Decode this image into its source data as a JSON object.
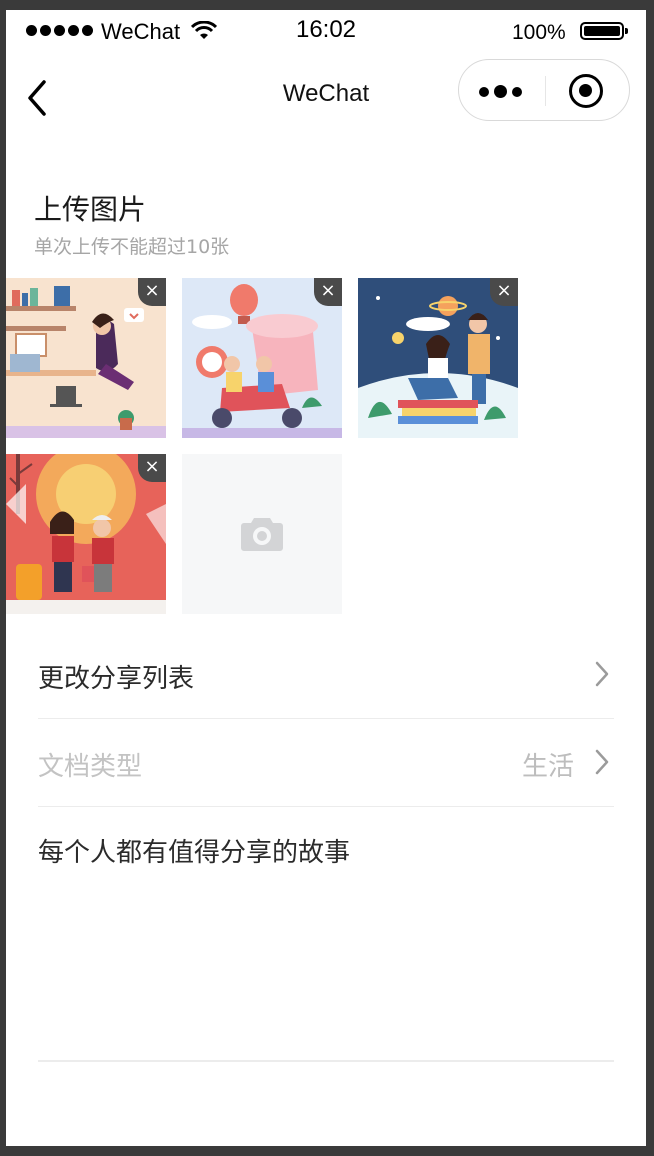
{
  "status_bar": {
    "carrier": "WeChat",
    "time": "16:02",
    "battery": "100%"
  },
  "nav": {
    "title": "WeChat",
    "back_icon": "chevron-left-icon",
    "more_icon": "more-dots-icon",
    "close_icon": "target-circle-icon"
  },
  "upload": {
    "title": "上传图片",
    "subtitle": "单次上传不能超过10张",
    "images": [
      {
        "name": "office-illustration",
        "delete_icon": "close-icon"
      },
      {
        "name": "scooter-delivery-illustration",
        "delete_icon": "close-icon"
      },
      {
        "name": "reading-couple-illustration",
        "delete_icon": "close-icon"
      },
      {
        "name": "winter-shopping-illustration",
        "delete_icon": "close-icon"
      }
    ],
    "delete_glyph": "×",
    "add_icon": "camera-icon"
  },
  "list": {
    "share_list_label": "更改分享列表",
    "doc_type_label": "文档类型",
    "doc_type_value": "生活"
  },
  "story": {
    "placeholder": "每个人都有值得分享的故事"
  }
}
